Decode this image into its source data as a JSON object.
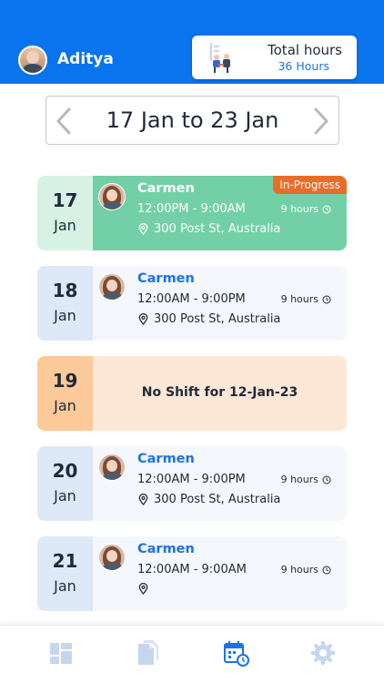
{
  "header": {
    "user_name": "Aditya",
    "total_hours_title": "Total hours",
    "total_hours_value": "36 Hours"
  },
  "date_nav": {
    "range": "17 Jan to 23 Jan"
  },
  "shifts": [
    {
      "day": "17",
      "month": "Jan",
      "name": "Carmen",
      "time": "12:00PM - 9:00AM",
      "duration": "9 hours",
      "location": "300 Post St, Australia",
      "badge": "In-Progress"
    },
    {
      "day": "18",
      "month": "Jan",
      "name": "Carmen",
      "time": "12:00AM - 9:00PM",
      "duration": "9 hours",
      "location": "300 Post St, Australia"
    },
    {
      "day": "19",
      "month": "Jan",
      "message": "No Shift for 12-Jan-23"
    },
    {
      "day": "20",
      "month": "Jan",
      "name": "Carmen",
      "time": "12:00AM - 9:00PM",
      "duration": "9 hours",
      "location": "300 Post St, Australia"
    },
    {
      "day": "21",
      "month": "Jan",
      "name": "Carmen",
      "time": "12:00AM - 9:00AM",
      "duration": "9 hours",
      "location": ""
    }
  ],
  "bottom_nav": {
    "items": [
      {
        "icon": "dashboard-icon",
        "active": false
      },
      {
        "icon": "documents-icon",
        "active": false
      },
      {
        "icon": "calendar-clock-icon",
        "active": true
      },
      {
        "icon": "settings-gear-icon",
        "active": false
      }
    ]
  },
  "colors": {
    "brand": "#0a74ee",
    "in_progress_card": "#73d0a6",
    "in_progress_badge": "#e86d2a",
    "no_shift_card": "#fde7d6",
    "nav_inactive": "#c5d6ee"
  }
}
